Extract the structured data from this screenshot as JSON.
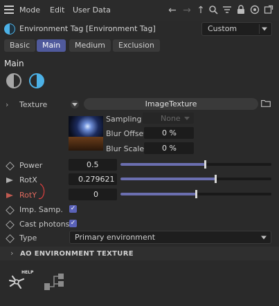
{
  "menubar": {
    "items": [
      "Mode",
      "Edit",
      "User Data"
    ],
    "icons": [
      "arrow-left-icon",
      "arrow-right-icon",
      "arrow-up-icon",
      "search-icon",
      "filter-icon",
      "lock-icon",
      "target-icon",
      "new-window-icon"
    ]
  },
  "title": {
    "text": "Environment Tag [Environment Tag]",
    "preset": "Custom"
  },
  "tabs": [
    {
      "label": "Basic",
      "active": false
    },
    {
      "label": "Main",
      "active": true
    },
    {
      "label": "Medium",
      "active": false
    },
    {
      "label": "Exclusion",
      "active": false
    }
  ],
  "section": {
    "title": "Main"
  },
  "texture": {
    "label": "Texture",
    "value": "ImageTexture",
    "sampling_label": "Sampling",
    "sampling_value": "None",
    "blur_offset_label": "Blur Offset",
    "blur_offset_value": "0 %",
    "blur_scale_label": "Blur Scale",
    "blur_scale_value": "0 %"
  },
  "params": {
    "power": {
      "label": "Power",
      "value": "0.5",
      "fraction": 0.56
    },
    "rotx": {
      "label": "RotX",
      "value": "0.279621",
      "fraction": 0.63
    },
    "roty": {
      "label": "RotY",
      "value": "0",
      "fraction": 0.5
    },
    "imp_samp": {
      "label": "Imp. Samp.",
      "checked": true
    },
    "cast_photons": {
      "label": "Cast photons",
      "checked": true
    },
    "type": {
      "label": "Type",
      "value": "Primary environment"
    }
  },
  "ao_section": {
    "title": "AO ENVIRONMENT TEXTURE"
  },
  "bottom": {
    "help_label": "HELP"
  },
  "colors": {
    "accent": "#505a9c",
    "slider": "#6b6fb0",
    "red_label": "#e06a5e",
    "tag_blue": "#4cb1e6"
  }
}
